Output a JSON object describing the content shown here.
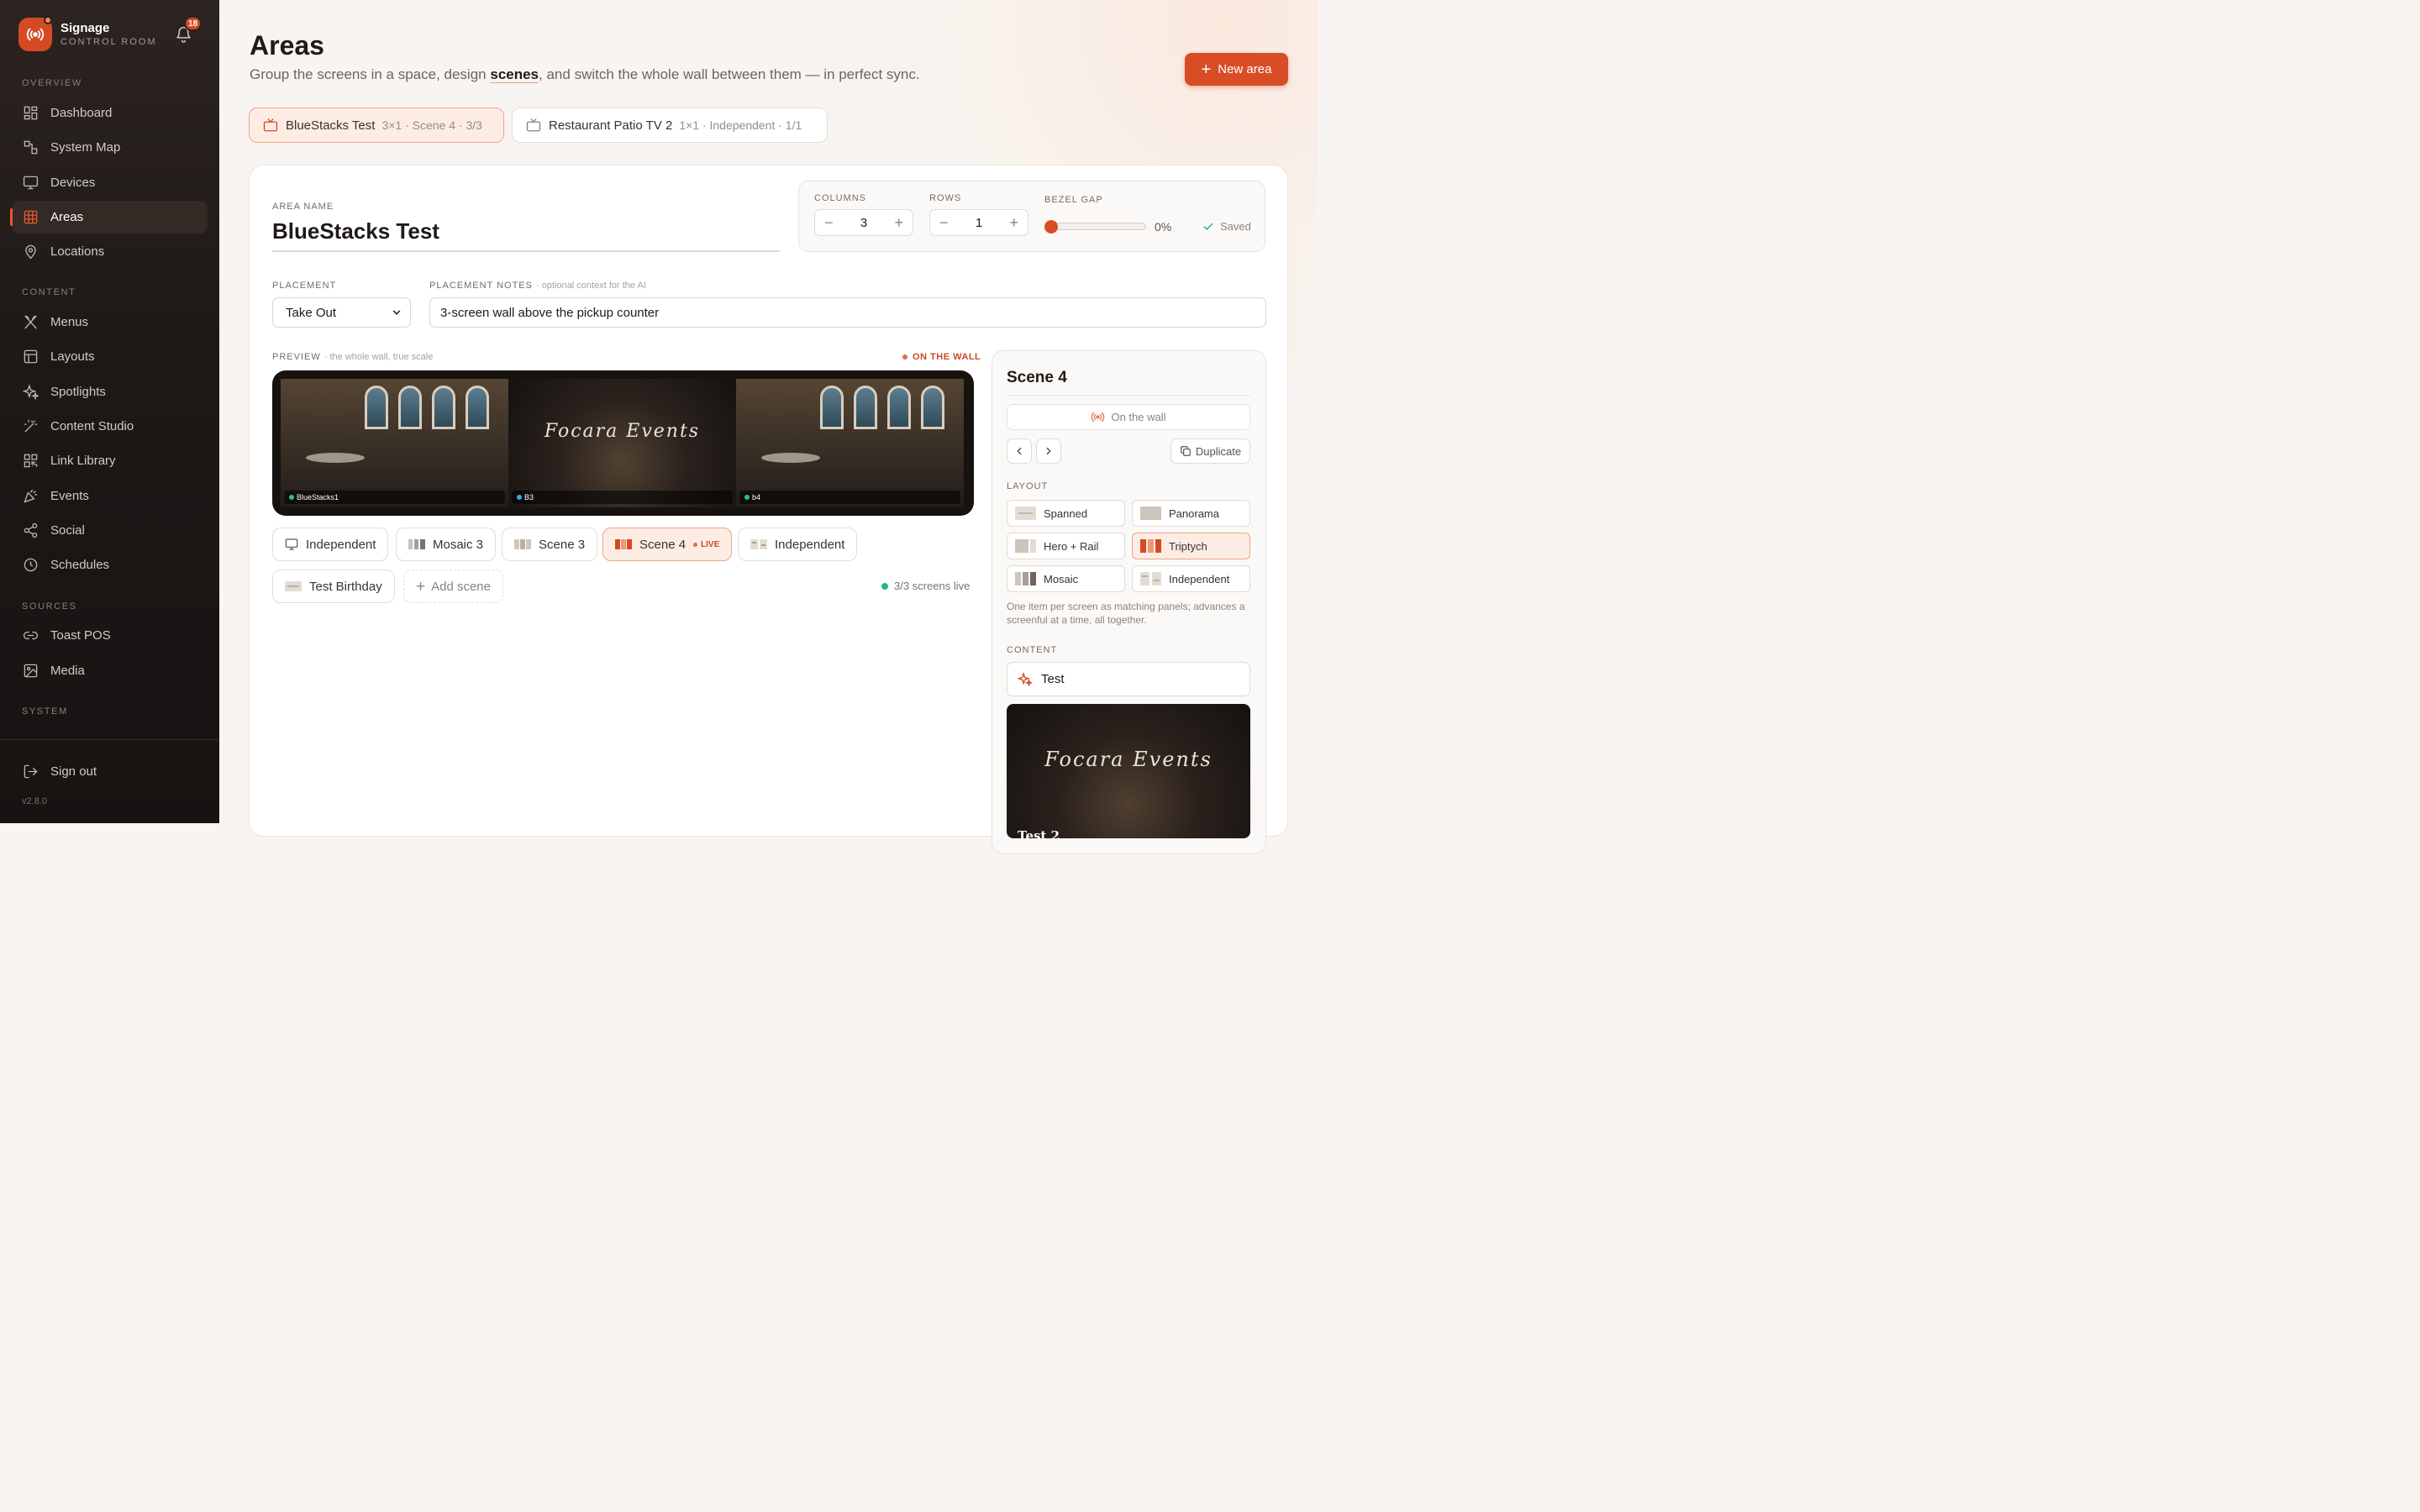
{
  "app": {
    "name": "Signage",
    "subtitle": "CONTROL ROOM",
    "notifications": "18",
    "version": "v2.8.0"
  },
  "sidebar": {
    "sections": [
      {
        "label": "OVERVIEW"
      },
      {
        "label": "CONTENT"
      },
      {
        "label": "SOURCES"
      },
      {
        "label": "SYSTEM"
      }
    ],
    "items": [
      {
        "label": "Dashboard",
        "icon": "grid-icon"
      },
      {
        "label": "System Map",
        "icon": "map-nodes-icon"
      },
      {
        "label": "Devices",
        "icon": "monitor-icon"
      },
      {
        "label": "Areas",
        "icon": "areas-grid-icon",
        "active": true
      },
      {
        "label": "Locations",
        "icon": "location-pin-icon"
      },
      {
        "label": "Menus",
        "icon": "utensils-icon"
      },
      {
        "label": "Layouts",
        "icon": "layout-icon"
      },
      {
        "label": "Spotlights",
        "icon": "sparkle-icon"
      },
      {
        "label": "Content Studio",
        "icon": "wand-icon"
      },
      {
        "label": "Link Library",
        "icon": "qr-icon"
      },
      {
        "label": "Events",
        "icon": "party-icon"
      },
      {
        "label": "Social",
        "icon": "share-icon"
      },
      {
        "label": "Schedules",
        "icon": "clock-icon"
      },
      {
        "label": "Toast POS",
        "icon": "link-icon"
      },
      {
        "label": "Media",
        "icon": "image-icon"
      }
    ],
    "sign_out": "Sign out"
  },
  "page": {
    "title": "Areas",
    "subtitle_before": "Group the screens in a space, design",
    "subtitle_highlight": "scenes",
    "subtitle_after": ", and switch the whole wall between them — in perfect sync.",
    "new_area": "New area"
  },
  "area_tabs": [
    {
      "name": "BlueStacks Test",
      "meta": "3×1 · Scene 4 · 3/3",
      "active": true
    },
    {
      "name": "Restaurant Patio TV 2",
      "meta": "1×1 · Independent · 1/1",
      "active": false
    }
  ],
  "editor": {
    "area_name_label": "AREA NAME",
    "area_name": "BlueStacks Test",
    "columns_label": "COLUMNS",
    "columns": "3",
    "rows_label": "ROWS",
    "rows": "1",
    "bezel_label": "BEZEL GAP",
    "bezel_gap": "0%",
    "bezel_value": 0,
    "saved": "Saved",
    "placement_label": "PLACEMENT",
    "placement": "Take Out",
    "notes_label": "PLACEMENT NOTES",
    "notes_hint": "· optional context for the AI",
    "notes": "3-screen wall above the pickup counter"
  },
  "preview": {
    "label": "PREVIEW",
    "hint": "· the whole wall, true scale",
    "status": "ON THE WALL",
    "screens": [
      {
        "name": "BlueStacks1",
        "dot": "#27c28f"
      },
      {
        "name": "B3",
        "dot": "#3aa7e8"
      },
      {
        "name": "b4",
        "dot": "#27c28f"
      }
    ],
    "event_text": "Focara Events"
  },
  "scenes": [
    {
      "label": "Independent",
      "icon": "monitor-icon"
    },
    {
      "label": "Mosaic 3",
      "icon": "mosaic-icon"
    },
    {
      "label": "Scene 3",
      "icon": "triptych-icon"
    },
    {
      "label": "Scene 4",
      "icon": "triptych-active-icon",
      "live": "LIVE",
      "active": true
    },
    {
      "label": "Independent",
      "icon": "independent-icon"
    },
    {
      "label": "Test Birthday",
      "icon": "spanned-icon"
    }
  ],
  "add_scene": "Add scene",
  "screens_live": "3/3 screens live",
  "scene_panel": {
    "title": "Scene 4",
    "on_wall": "On the wall",
    "duplicate": "Duplicate",
    "layout_label": "LAYOUT",
    "layouts": [
      {
        "label": "Spanned"
      },
      {
        "label": "Panorama"
      },
      {
        "label": "Hero + Rail"
      },
      {
        "label": "Triptych",
        "active": true
      },
      {
        "label": "Mosaic"
      },
      {
        "label": "Independent"
      }
    ],
    "layout_desc": "One item per screen as matching panels; advances a screenful at a time, all together.",
    "content_label": "CONTENT",
    "content_item": "Test",
    "thumb_caption": "Test 2"
  },
  "colors": {
    "accent": "#d84d26",
    "live_green": "#23b57f",
    "sidebar_bg": "#1d1816"
  }
}
